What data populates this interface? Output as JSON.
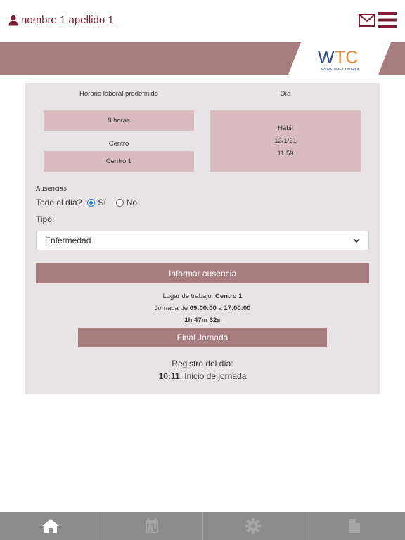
{
  "header": {
    "user_name": "nombre 1 apellido 1",
    "icons": {
      "user": "user-icon",
      "mail": "mail-icon",
      "menu": "hamburger-menu-icon"
    }
  },
  "logo": {
    "text": "WTC",
    "tagline": "WORK TIME CONTROL",
    "colors": {
      "w": "#2f4e8c",
      "tc": "#e8892f"
    }
  },
  "schedule": {
    "horario_label": "Horario laboral predefinido",
    "horario_value": "8 horas",
    "centro_label": "Centro",
    "centro_value": "Centro 1",
    "dia_label": "Día",
    "dia_type": "Hábil",
    "dia_date": "12/1/21",
    "dia_time": "11:59"
  },
  "absences": {
    "section_label": "Ausencias",
    "todo_dia_label": "Todo el día?",
    "option_yes": "Sí",
    "option_no": "No",
    "selected": "Sí",
    "tipo_label": "Tipo:",
    "tipo_value": "Enfermedad",
    "report_button": "Informar ausencia"
  },
  "workday": {
    "lugar_prefix": "Lugar de trabajo: ",
    "lugar_value": "Centro 1",
    "jornada_prefix": "Jornada de ",
    "jornada_start": "09:00:00",
    "jornada_mid": " a ",
    "jornada_end": "17:00:00",
    "elapsed": "1h 47m 32s",
    "end_button": "Final Jornada"
  },
  "registry": {
    "title": "Registro del día:",
    "time": "10:11",
    "event": ": Inicio de jornada"
  },
  "tabbar": [
    {
      "icon": "home-icon",
      "active": true
    },
    {
      "icon": "calendar-icon",
      "active": false
    },
    {
      "icon": "gear-icon",
      "active": false
    },
    {
      "icon": "document-icon",
      "active": false
    }
  ],
  "colors": {
    "accent": "#a87d7f",
    "pink_box": "#d8bcc0",
    "card_bg": "#e8e4e5",
    "brand_dark": "#7a1f35",
    "tabbar": "#8c8c8c"
  }
}
